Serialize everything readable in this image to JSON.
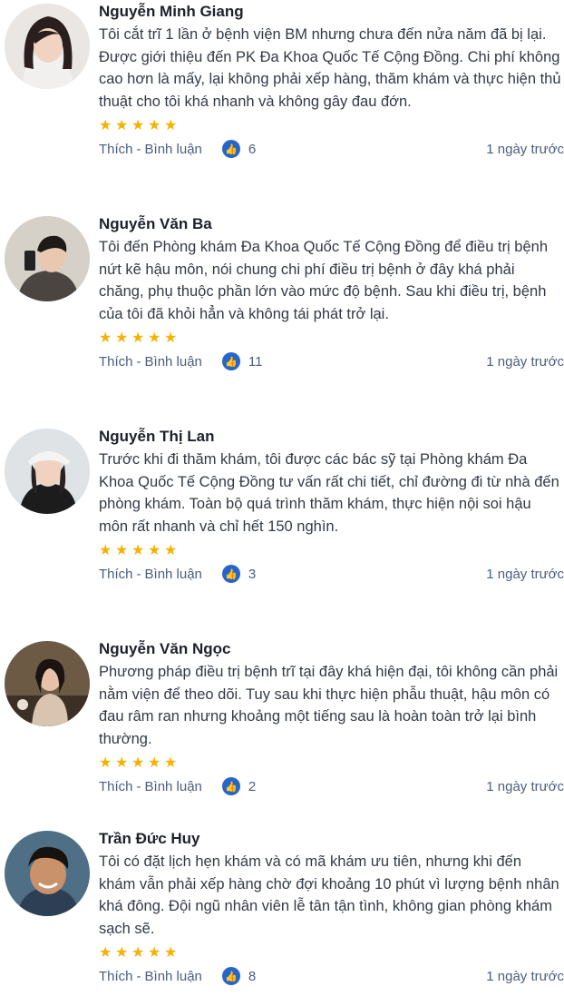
{
  "reviews": [
    {
      "name": "Nguyễn Minh Giang",
      "text": "Tôi cắt trĩ 1 lần ở bệnh viện BM nhưng chưa đến nửa năm đã bị lại. Được giới thiệu đến PK Đa Khoa Quốc Tế Cộng Đồng. Chi phí không cao hơn là mấy, lại không phải xếp hàng, thăm khám và thực hiện thủ thuật cho tôi khá nhanh và không gây đau đớn.",
      "rating": 5,
      "like_label": "Thích",
      "comment_label": "Bình luận",
      "likes": "6",
      "time": "1 ngày trước"
    },
    {
      "name": "Nguyễn Văn Ba",
      "text": "Tôi đến Phòng khám Đa Khoa Quốc Tế Cộng Đồng để điều trị bệnh nứt kẽ hậu môn, nói chung chi phí điều trị bệnh ở đây khá phải chăng, phụ thuộc phần lớn vào mức độ bệnh. Sau khi điều trị, bệnh của tôi đã khỏi hẳn và không tái phát trở lại.",
      "rating": 5,
      "like_label": "Thích",
      "comment_label": "Bình luận",
      "likes": "11",
      "time": "1 ngày trước"
    },
    {
      "name": "Nguyễn Thị Lan",
      "text": "Trước khi đi thăm khám, tôi được các bác sỹ tại Phòng khám Đa Khoa Quốc Tế Cộng Đồng tư vấn rất chi tiết, chỉ đường đi từ nhà đến phòng khám. Toàn bộ quá trình thăm khám, thực hiện nội soi hậu môn rất nhanh và chỉ hết 150 nghìn.",
      "rating": 5,
      "like_label": "Thích",
      "comment_label": "Bình luận",
      "likes": "3",
      "time": "1 ngày trước"
    },
    {
      "name": "Nguyễn Văn Ngọc",
      "text": "Phương pháp điều trị bệnh trĩ tại đây khá hiện đại, tôi không cần phải nằm viện để theo dõi. Tuy sau khi thực hiện phẫu thuật, hậu môn có đau râm ran nhưng khoảng một tiếng sau là hoàn toàn trở lại bình thường.",
      "rating": 5,
      "like_label": "Thích",
      "comment_label": "Bình luận",
      "likes": "2",
      "time": "1 ngày trước"
    },
    {
      "name": "Trần Đức Huy",
      "text": "Tôi có đặt lịch hẹn khám và có mã khám ưu tiên, nhưng khi đến khám vẫn phải xếp hàng chờ đợi khoảng 10 phút vì lượng bệnh nhân khá đông. Đội ngũ nhân viên lễ tân tận tình, không gian phòng khám sạch sẽ.",
      "rating": 5,
      "like_label": "Thích",
      "comment_label": "Bình luận",
      "likes": "8",
      "time": "1 ngày trước"
    }
  ],
  "separator": "-",
  "colors": {
    "star": "#f5b301",
    "like_badge": "#2766c8",
    "action_text": "#4b5e7d"
  },
  "icons": {
    "star": "star-icon",
    "like": "thumbs-up-icon"
  }
}
